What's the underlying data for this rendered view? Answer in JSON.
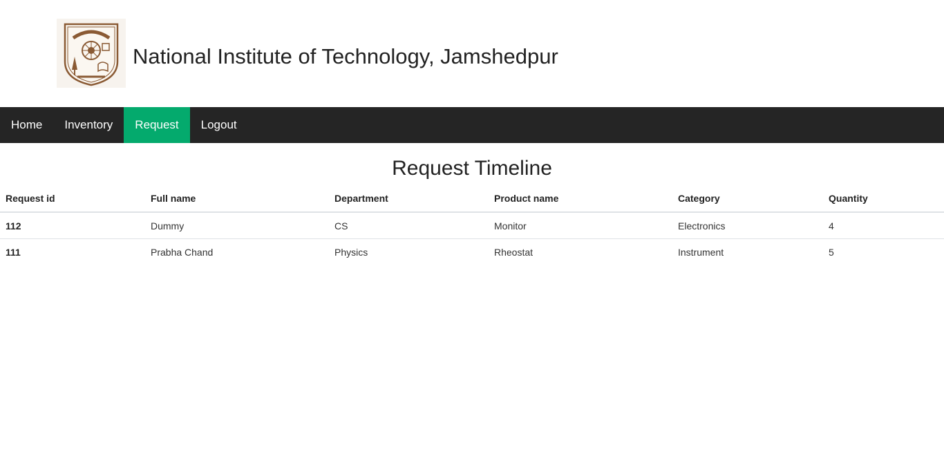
{
  "header": {
    "title": "National Institute of Technology, Jamshedpur",
    "logo_icon": "institute-emblem"
  },
  "nav": {
    "items": [
      {
        "label": "Home",
        "active": false
      },
      {
        "label": "Inventory",
        "active": false
      },
      {
        "label": "Request",
        "active": true
      },
      {
        "label": "Logout",
        "active": false
      }
    ],
    "bg_color": "#252525",
    "active_color": "#04aa6d"
  },
  "main": {
    "heading": "Request Timeline",
    "table": {
      "columns": [
        "Request id",
        "Full name",
        "Department",
        "Product name",
        "Category",
        "Quantity"
      ],
      "rows": [
        [
          "112",
          "Dummy",
          "CS",
          "Monitor",
          "Electronics",
          "4"
        ],
        [
          "111",
          "Prabha Chand",
          "Physics",
          "Rheostat",
          "Instrument",
          "5"
        ]
      ]
    }
  }
}
